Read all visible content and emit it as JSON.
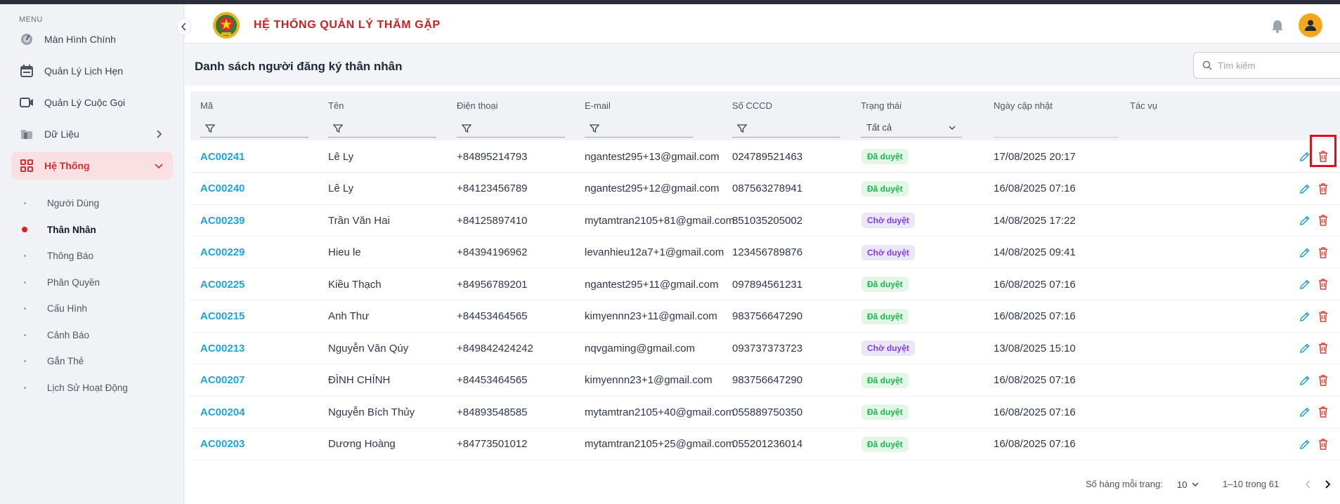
{
  "app": {
    "title": "HỆ THỐNG QUẢN LÝ THĂM GẶP"
  },
  "sidebar": {
    "caption": "MENU",
    "items": [
      {
        "label": "Màn Hình Chính",
        "icon": "dashboard-gauge-icon"
      },
      {
        "label": "Quản Lý Lịch Hẹn",
        "icon": "calendar-icon"
      },
      {
        "label": "Quản Lý Cuộc Gọi",
        "icon": "video-camera-icon"
      },
      {
        "label": "Dữ Liệu",
        "icon": "folder-icon"
      },
      {
        "label": "Hệ Thống",
        "icon": "grid-apps-icon",
        "active": true
      }
    ],
    "sub_items": [
      {
        "label": "Người Dùng"
      },
      {
        "label": "Thân Nhân",
        "active": true
      },
      {
        "label": "Thông Báo"
      },
      {
        "label": "Phân Quyền"
      },
      {
        "label": "Cấu Hình"
      },
      {
        "label": "Cảnh Báo"
      },
      {
        "label": "Gắn Thẻ"
      },
      {
        "label": "Lịch Sử Hoạt Động"
      }
    ]
  },
  "page": {
    "title": "Danh sách người đăng ký thân nhân",
    "search_placeholder": "Tìm kiếm"
  },
  "table": {
    "columns": [
      "Mã",
      "Tên",
      "Điện thoại",
      "E-mail",
      "Số CCCD",
      "Trạng thái",
      "Ngày cập nhật",
      "Tác vụ"
    ],
    "status_filter_value": "Tất cả",
    "rows": [
      {
        "code": "AC00241",
        "name": "Lê Ly",
        "phone": "+84895214793",
        "email": "ngantest295+13@gmail.com",
        "cccd": "024789521463",
        "status": "Đã duyệt",
        "updated": "17/08/2025 20:17"
      },
      {
        "code": "AC00240",
        "name": "Lê Ly",
        "phone": "+84123456789",
        "email": "ngantest295+12@gmail.com",
        "cccd": "087563278941",
        "status": "Đã duyệt",
        "updated": "16/08/2025 07:16"
      },
      {
        "code": "AC00239",
        "name": "Trần Văn Hai",
        "phone": "+84125897410",
        "email": "mytamtran2105+81@gmail.com",
        "cccd": "851035205002",
        "status": "Chờ duyệt",
        "updated": "14/08/2025 17:22"
      },
      {
        "code": "AC00229",
        "name": "Hieu le",
        "phone": "+84394196962",
        "email": "levanhieu12a7+1@gmail.com",
        "cccd": "123456789876",
        "status": "Chờ duyệt",
        "updated": "14/08/2025 09:41"
      },
      {
        "code": "AC00225",
        "name": "Kiều Thạch",
        "phone": "+84956789201",
        "email": "ngantest295+11@gmail.com",
        "cccd": "097894561231",
        "status": "Đã duyệt",
        "updated": "16/08/2025 07:16"
      },
      {
        "code": "AC00215",
        "name": "Anh Thư",
        "phone": "+84453464565",
        "email": "kimyennn23+11@gmail.com",
        "cccd": "983756647290",
        "status": "Đã duyệt",
        "updated": "16/08/2025 07:16"
      },
      {
        "code": "AC00213",
        "name": "Nguyễn Văn Qúy",
        "phone": "+849842424242",
        "email": "nqvgaming@gmail.com",
        "cccd": "093737373723",
        "status": "Chờ duyệt",
        "updated": "13/08/2025 15:10"
      },
      {
        "code": "AC00207",
        "name": "ĐÌNH CHÍNH",
        "phone": "+84453464565",
        "email": "kimyennn23+1@gmail.com",
        "cccd": "983756647290",
        "status": "Đã duyệt",
        "updated": "16/08/2025 07:16"
      },
      {
        "code": "AC00204",
        "name": "Nguyễn Bích Thủy",
        "phone": "+84893548585",
        "email": "mytamtran2105+40@gmail.com",
        "cccd": "055889750350",
        "status": "Đã duyệt",
        "updated": "16/08/2025 07:16"
      },
      {
        "code": "AC00203",
        "name": "Dương Hoàng",
        "phone": "+84773501012",
        "email": "mytamtran2105+25@gmail.com",
        "cccd": "055201236014",
        "status": "Đã duyệt",
        "updated": "16/08/2025 07:16"
      }
    ]
  },
  "pagination": {
    "rows_per_page_label": "Số hàng mỗi trang:",
    "rows_per_page": "10",
    "range": "1–10 trong 61"
  },
  "colors": {
    "brand_red": "#cc1f1f",
    "link_blue": "#1fa3dc",
    "approved_green": "#20b24a",
    "pending_purple": "#7b3fe4",
    "delete_red": "#e5392b",
    "avatar_amber": "#f3a81b"
  }
}
